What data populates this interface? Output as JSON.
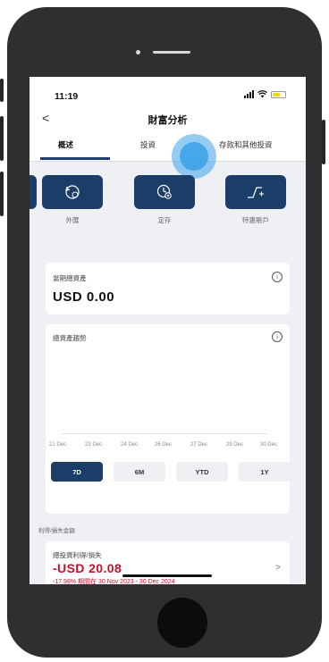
{
  "status_bar": {
    "time": "11:19"
  },
  "nav": {
    "back_icon": "chevron-left-icon",
    "back_glyph": "<",
    "title": "財富分析"
  },
  "tabs": [
    {
      "label": "概述",
      "active": true
    },
    {
      "label": "投資",
      "active": false
    },
    {
      "label": "存款和其他投資",
      "active": false
    }
  ],
  "quick_actions": [
    {
      "label": "外匯",
      "icon": "fx-exchange-icon"
    },
    {
      "label": "定存",
      "icon": "time-deposit-icon"
    },
    {
      "label": "特惠賬戶",
      "icon": "growth-account-icon"
    }
  ],
  "total_assets": {
    "label": "當期總資產",
    "info_glyph": "i",
    "amount": "USD 0.00"
  },
  "trend": {
    "label": "總資產趨勢",
    "info_glyph": "i",
    "dates": [
      "21 Dec",
      "23 Dec",
      "24 Dec",
      "26 Dec",
      "27 Dec",
      "29 Dec",
      "30 Dec"
    ],
    "ranges": [
      {
        "label": "7D",
        "active": true
      },
      {
        "label": "6M",
        "active": false
      },
      {
        "label": "YTD",
        "active": false
      },
      {
        "label": "1Y",
        "active": false
      }
    ]
  },
  "profit_loss": {
    "section_label": "利得/損失金額",
    "label": "總投資利得/損失",
    "amount": "-USD 20.08",
    "sub": "-17.98% 期間在 30 Nov 2023 - 30 Dec 2024",
    "chevron": ">"
  },
  "colors": {
    "accent_navy": "#1a3e68",
    "loss_red": "#c8102e",
    "touch_blue": "#3aa0e8"
  }
}
